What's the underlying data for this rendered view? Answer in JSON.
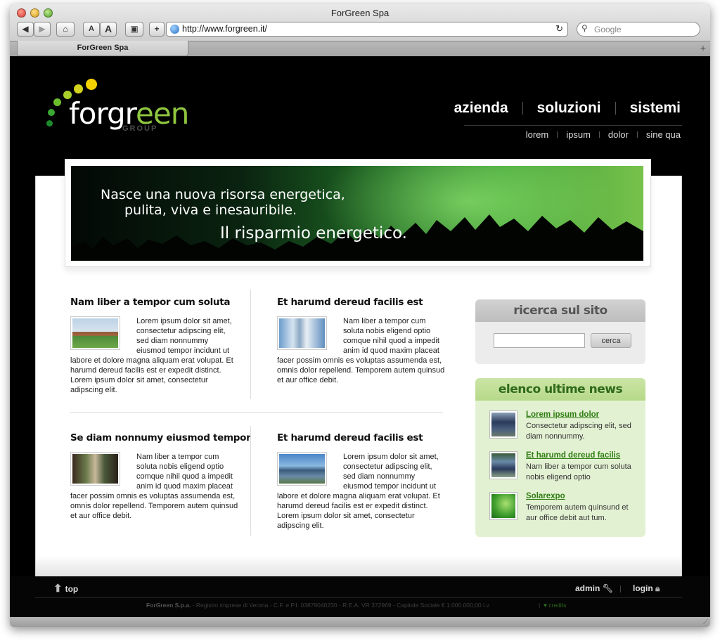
{
  "browser": {
    "window_title": "ForGreen Spa",
    "tab_title": "ForGreen Spa",
    "url": "http://www.forgreen.it/",
    "search_placeholder": "Google",
    "text_small_label": "A",
    "text_large_label": "A",
    "new_tab_label": "+",
    "add_bookmark_label": "+"
  },
  "logo": {
    "text_main": "forgr",
    "text_accent": "een",
    "group": "GROUP",
    "dot_colors": [
      "#1e8a2e",
      "#3aa832",
      "#6cbf2c",
      "#a9cf2a",
      "#d4d41e",
      "#f4d100"
    ]
  },
  "nav": {
    "main": [
      "azienda",
      "soluzioni",
      "sistemi"
    ],
    "sub": [
      "lorem",
      "ipsum",
      "dolor",
      "sine qua"
    ]
  },
  "banner": {
    "line1": "Nasce una nuova risorsa energetica,",
    "line2": "pulita, viva e inesauribile.",
    "line3": "Il risparmio energetico."
  },
  "articles": [
    {
      "title": "Nam liber a tempor cum soluta",
      "text": "Lorem ipsum dolor sit amet, consectetur adipscing elit, sed diam nonnummy eiusmod tempor incidunt ut labore et dolore magna aliquam erat volupat. Et harumd dereud facilis est er expedit distinct. Lorem ipsum dolor sit amet, consectetur adipscing elit."
    },
    {
      "title": "Et harumd dereud facilis est",
      "text": "Nam liber a tempor cum soluta nobis eligend optio comque nihil quod a impedit anim id quod maxim placeat facer possim omnis es voluptas assumenda est, omnis dolor repellend. Temporem autem quinsud et aur office debit."
    },
    {
      "title": "Se diam nonnumy eiusmod tempor",
      "text": "Nam liber a tempor cum soluta nobis eligend optio comque nihil quod a impedit anim id quod maxim placeat facer possim omnis es voluptas assumenda est, omnis dolor repellend. Temporem autem quinsud et aur office debit."
    },
    {
      "title": "Et harumd dereud facilis est",
      "text": "Lorem ipsum dolor sit amet, consectetur adipscing elit, sed diam nonnummy eiusmod tempor incidunt ut labore et dolore magna aliquam erat volupat. Et harumd dereud facilis est er expedit distinct. Lorem ipsum dolor sit amet, consectetur adipscing elit."
    }
  ],
  "search_box": {
    "title": "ricerca sul sito",
    "input_value": "",
    "button": "cerca"
  },
  "news_box": {
    "title": "elenco ultime news",
    "items": [
      {
        "title": "Lorem ipsum dolor",
        "text": "Consectetur adipscing elit, sed diam nonnummy."
      },
      {
        "title": "Et harumd dereud facilis",
        "text": "Nam liber a tempor cum soluta nobis eligend optio"
      },
      {
        "title": "Solarexpo",
        "text": "Temporem autem quinsund et aur office debit aut tum."
      }
    ]
  },
  "footer": {
    "top": "top",
    "admin": "admin",
    "login": "login",
    "company": "ForGreen S.p.a.",
    "legal": " - Registro imprese di Verona - C.F. e P.I. 03879040230 - R.E.A. VR 372969 - Capitale Sociale € 1.000.000,00 i.v.",
    "credits": "credits"
  },
  "colors": {
    "accent_green": "#8fc63f",
    "news_title_green": "#2e7d12",
    "header_black": "#000000"
  }
}
